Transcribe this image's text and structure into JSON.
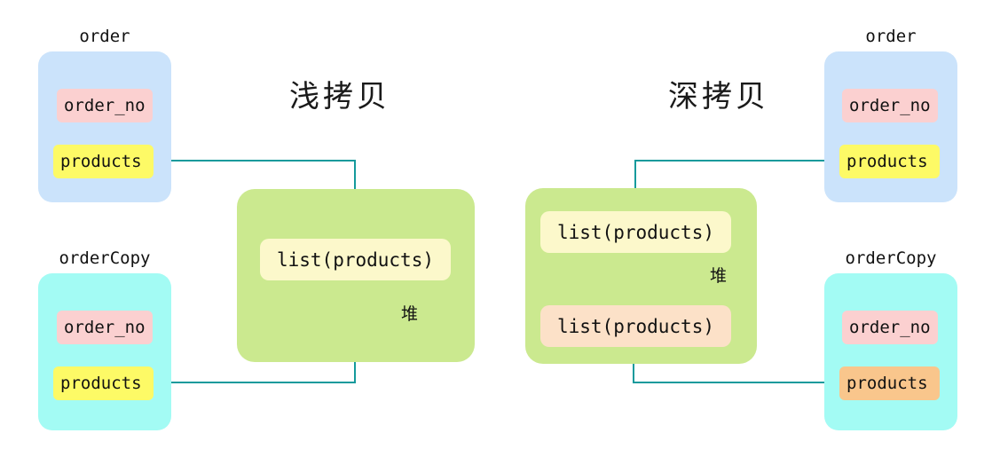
{
  "diagram": {
    "title_shallow": "浅拷贝",
    "title_deep": "深拷贝",
    "heap_label": "堆"
  },
  "colors": {
    "background": "#ffffff",
    "object_blue": "#cbe3fb",
    "object_cyan": "#a3fbf4",
    "heap_green": "#cbe98f",
    "field_pink": "#fbd0d0",
    "field_yellow": "#fdfa66",
    "field_orange": "#f9c68c",
    "heap_ivory": "#fcf8cb",
    "heap_peach": "#fce1c8",
    "connector": "#159a9c",
    "text": "#111111"
  },
  "shallow": {
    "order": {
      "caption": "order",
      "fields": [
        {
          "name": "order_no",
          "color": "pink"
        },
        {
          "name": "products",
          "color": "yellow"
        }
      ]
    },
    "order_copy": {
      "caption": "orderCopy",
      "fields": [
        {
          "name": "order_no",
          "color": "pink"
        },
        {
          "name": "products",
          "color": "yellow"
        }
      ]
    },
    "heap": {
      "label": "堆",
      "items": [
        {
          "name": "list(products)",
          "color": "ivory"
        }
      ]
    }
  },
  "deep": {
    "order": {
      "caption": "order",
      "fields": [
        {
          "name": "order_no",
          "color": "pink"
        },
        {
          "name": "products",
          "color": "yellow"
        }
      ]
    },
    "order_copy": {
      "caption": "orderCopy",
      "fields": [
        {
          "name": "order_no",
          "color": "pink"
        },
        {
          "name": "products",
          "color": "orange"
        }
      ]
    },
    "heap": {
      "label": "堆",
      "items": [
        {
          "name": "list(products)",
          "color": "ivory"
        },
        {
          "name": "list(products)",
          "color": "peach"
        }
      ]
    }
  }
}
